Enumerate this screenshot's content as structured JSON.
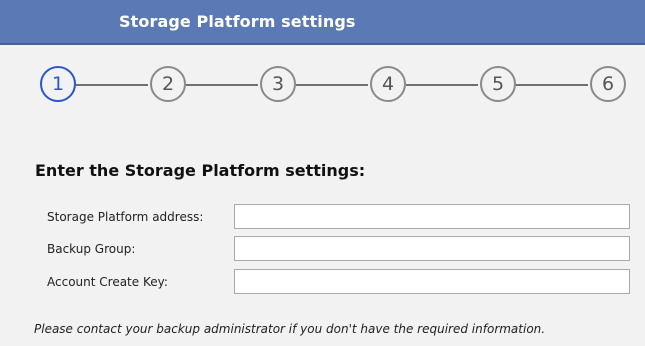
{
  "window": {
    "title": "Storage Platform settings"
  },
  "wizard": {
    "steps": [
      "1",
      "2",
      "3",
      "4",
      "5",
      "6"
    ],
    "active_step": 1
  },
  "form": {
    "heading": "Enter the Storage Platform settings:",
    "fields": [
      {
        "label": "Storage Platform address:",
        "value": ""
      },
      {
        "label": "Backup Group:",
        "value": ""
      },
      {
        "label": "Account Create Key:",
        "value": ""
      }
    ]
  },
  "note": "Please contact your backup administrator if you don't have the required information.",
  "colors": {
    "header_bg": "#5b7ab5",
    "active_step": "#2a56c8",
    "inactive_step": "#8a8a8a"
  }
}
